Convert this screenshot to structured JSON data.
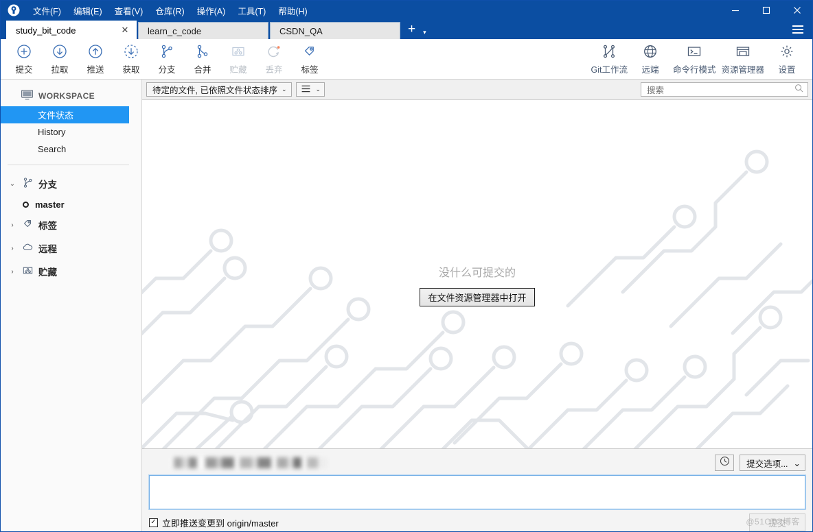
{
  "window": {
    "logo_icon": "sourcetree-logo-icon",
    "minimize_label": "─",
    "maximize_label": "□",
    "close_label": "✕"
  },
  "menubar": {
    "items": [
      {
        "label": "文件(F)",
        "name": "menu-file"
      },
      {
        "label": "编辑(E)",
        "name": "menu-edit"
      },
      {
        "label": "查看(V)",
        "name": "menu-view"
      },
      {
        "label": "仓库(R)",
        "name": "menu-repository"
      },
      {
        "label": "操作(A)",
        "name": "menu-actions"
      },
      {
        "label": "工具(T)",
        "name": "menu-tools"
      },
      {
        "label": "帮助(H)",
        "name": "menu-help"
      }
    ]
  },
  "tabs": {
    "items": [
      {
        "label": "study_bit_code",
        "active": true
      },
      {
        "label": "learn_c_code",
        "active": false
      },
      {
        "label": "CSDN_QA",
        "active": false
      }
    ],
    "add_label": "+",
    "caret_label": "▾",
    "close_label": "✕"
  },
  "toolbar": {
    "left": [
      {
        "label": "提交",
        "icon": "commit-plus-circle-icon",
        "disabled": false
      },
      {
        "label": "拉取",
        "icon": "pull-down-arrow-circle-icon",
        "disabled": false
      },
      {
        "label": "推送",
        "icon": "push-up-arrow-circle-icon",
        "disabled": false
      },
      {
        "label": "获取",
        "icon": "fetch-dashed-circle-icon",
        "disabled": false
      },
      {
        "label": "分支",
        "icon": "branch-icon",
        "disabled": false
      },
      {
        "label": "合并",
        "icon": "merge-icon",
        "disabled": false
      },
      {
        "label": "贮藏",
        "icon": "stash-box-icon",
        "disabled": true
      },
      {
        "label": "丢弃",
        "icon": "discard-refresh-icon",
        "disabled": true
      },
      {
        "label": "标签",
        "icon": "tag-icon",
        "disabled": false
      }
    ],
    "right": [
      {
        "label": "Git工作流",
        "icon": "git-flow-icon"
      },
      {
        "label": "远端",
        "icon": "globe-remote-icon"
      },
      {
        "label": "命令行模式",
        "icon": "terminal-icon"
      },
      {
        "label": "资源管理器",
        "icon": "explorer-folder-icon"
      },
      {
        "label": "设置",
        "icon": "gear-icon"
      }
    ]
  },
  "sidebar": {
    "workspace_label": "WORKSPACE",
    "workspace_icon": "monitor-icon",
    "nav": [
      {
        "label": "文件状态",
        "selected": true
      },
      {
        "label": "History",
        "selected": false
      },
      {
        "label": "Search",
        "selected": false
      }
    ],
    "sections": [
      {
        "label": "分支",
        "icon": "branch-icon",
        "expanded": true,
        "chevron": "⌄"
      },
      {
        "label": "标签",
        "icon": "tag-icon",
        "expanded": false,
        "chevron": "›"
      },
      {
        "label": "远程",
        "icon": "cloud-icon",
        "expanded": false,
        "chevron": "›"
      },
      {
        "label": "贮藏",
        "icon": "stash-box-icon",
        "expanded": false,
        "chevron": "›"
      }
    ],
    "branches": [
      {
        "label": "master",
        "current": true
      }
    ]
  },
  "filterbar": {
    "file_filter_value": "待定的文件, 已依照文件状态排序",
    "file_filter_caret": "⌄",
    "view_mode_icon": "list-view-icon",
    "view_mode_caret": "⌄",
    "search_placeholder": "搜索",
    "search_value": "",
    "search_icon": "search-icon"
  },
  "main": {
    "empty_message": "没什么可提交的",
    "open_explorer_label": "在文件资源管理器中打开"
  },
  "commit_panel": {
    "author_redacted": true,
    "history_icon": "clock-history-icon",
    "commit_options_label": "提交选项...",
    "commit_options_caret": "⌄",
    "message_value": "",
    "push_checkbox_label": "立即推送变更到 origin/master",
    "push_checkbox_checked": true,
    "push_checkbox_mark": "✓",
    "commit_button_label": "提交",
    "commit_button_disabled": true
  },
  "watermark": {
    "text": "@51CTO博客"
  },
  "colors": {
    "titlebar_blue": "#0b4ea2",
    "accent_blue": "#2196f3",
    "icon_blue": "#3b6fb5",
    "disabled_gray": "#b9bfc6",
    "panel_gray": "#f4f4f4"
  }
}
